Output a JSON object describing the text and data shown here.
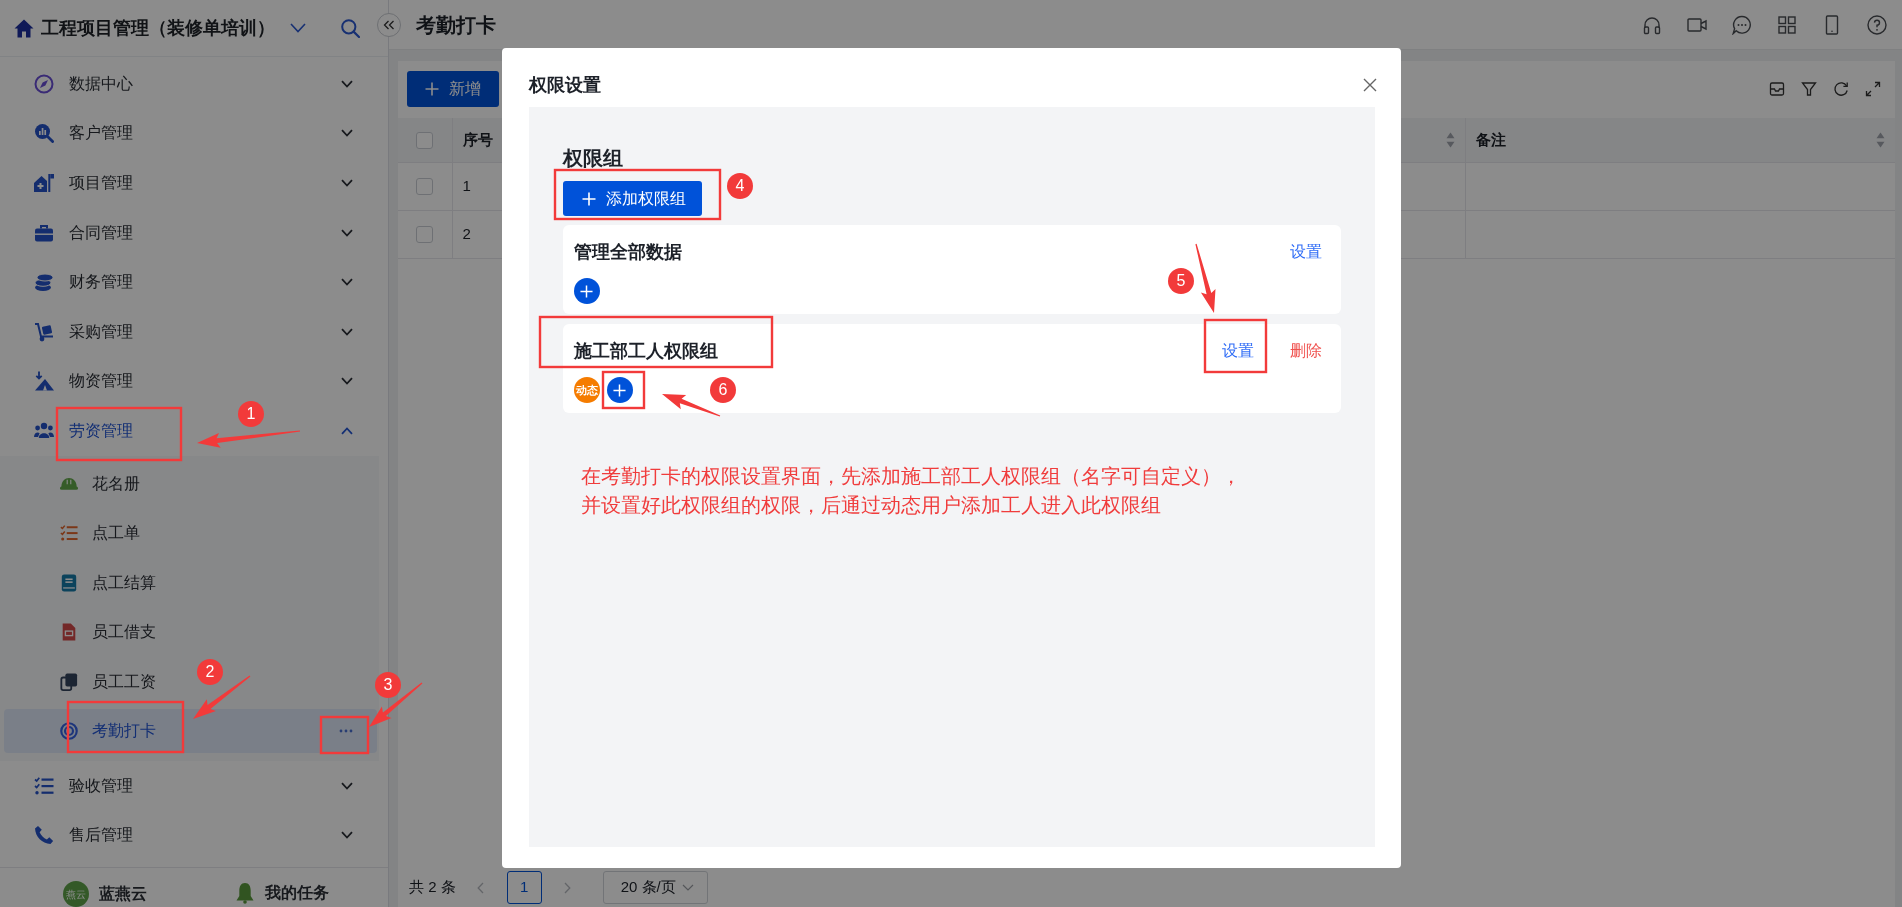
{
  "app": {
    "title": "工程项目管理（装修单培训）"
  },
  "sidebar": {
    "items": [
      {
        "label": "数据中心",
        "expanded": false
      },
      {
        "label": "客户管理",
        "expanded": false
      },
      {
        "label": "项目管理",
        "expanded": false
      },
      {
        "label": "合同管理",
        "expanded": false
      },
      {
        "label": "财务管理",
        "expanded": false
      },
      {
        "label": "采购管理",
        "expanded": false
      },
      {
        "label": "物资管理",
        "expanded": false
      },
      {
        "label": "劳资管理",
        "expanded": true,
        "children": [
          {
            "label": "花名册",
            "selected": false
          },
          {
            "label": "点工单",
            "selected": false
          },
          {
            "label": "点工结算",
            "selected": false
          },
          {
            "label": "员工借支",
            "selected": false
          },
          {
            "label": "员工工资",
            "selected": false
          },
          {
            "label": "考勤打卡",
            "selected": true
          }
        ]
      },
      {
        "label": "验收管理",
        "expanded": false
      },
      {
        "label": "售后管理",
        "expanded": false
      }
    ],
    "footer": [
      {
        "kind": "user",
        "label": "蓝燕云",
        "avatar": "燕云"
      },
      {
        "kind": "tasks",
        "label": "我的任务"
      }
    ]
  },
  "page": {
    "title": "考勤打卡"
  },
  "toolbar": {
    "buttons": [
      {
        "label": "新增"
      }
    ]
  },
  "table": {
    "select_all": {
      "checked": false
    },
    "columns": [
      {
        "label": "序号"
      },
      {
        "sortable": true
      },
      {
        "label": "备注",
        "sortable": true
      }
    ],
    "rows": [
      {
        "checked": false,
        "cells": [
          "1"
        ]
      },
      {
        "checked": false,
        "cells": [
          "2"
        ]
      }
    ]
  },
  "pagination": {
    "total": "共 2 条",
    "pages": [
      {
        "label": "1",
        "selected": true
      }
    ],
    "page_size": "20 条/页"
  },
  "dialog": {
    "title": "权限设置",
    "section_title": "权限组",
    "add_button": "添加权限组",
    "groups": [
      {
        "name": "管理全部数据",
        "actions": [
          {
            "label": "设置",
            "kind": "edit"
          }
        ]
      },
      {
        "name": "施工部工人权限组",
        "actions": [
          {
            "label": "设置",
            "kind": "edit"
          },
          {
            "label": "删除",
            "kind": "delete"
          }
        ],
        "members": [
          {
            "label": "动态"
          }
        ]
      }
    ],
    "note_lines": [
      "在考勤打卡的权限设置界面，先添加施工部工人权限组（名字可自定义），",
      "并设置好此权限组的权限，后通过动态用户添加工人进入此权限组"
    ]
  },
  "annotations": {
    "steps": [
      {
        "number": "1"
      },
      {
        "number": "2"
      },
      {
        "number": "3"
      },
      {
        "number": "4"
      },
      {
        "number": "5"
      },
      {
        "number": "6"
      }
    ]
  }
}
